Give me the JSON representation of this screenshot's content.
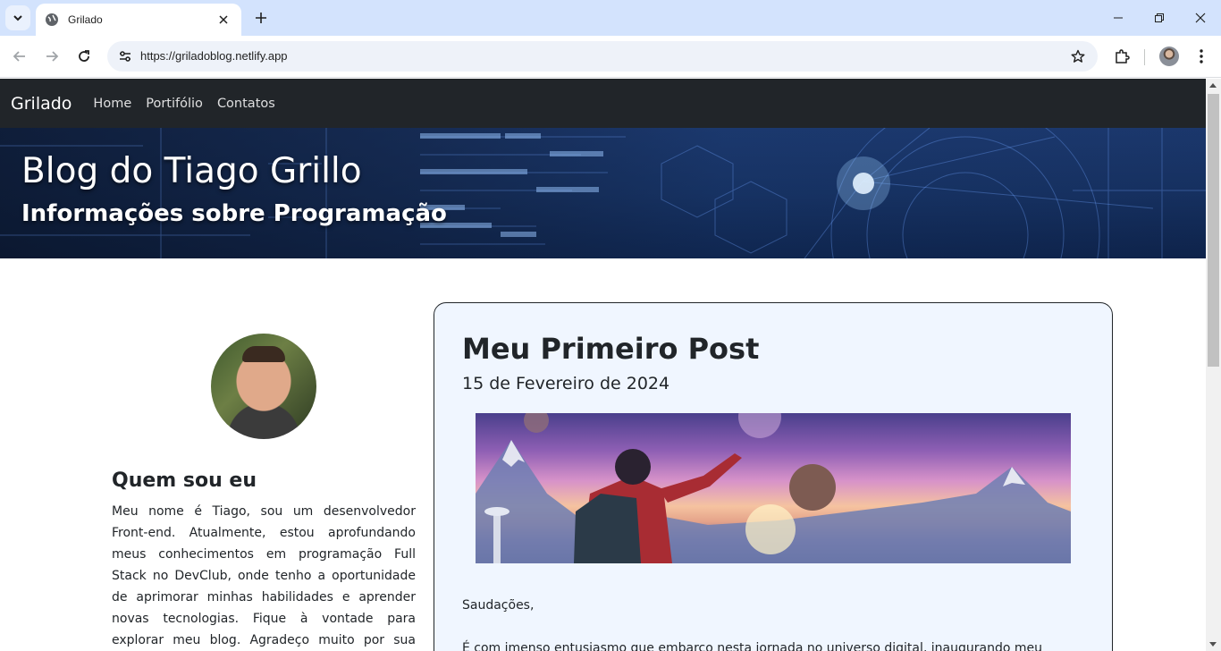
{
  "browser": {
    "tab_title": "Grilado",
    "url": "https://griladoblog.netlify.app"
  },
  "site": {
    "brand": "Grilado",
    "nav": [
      "Home",
      "Portifólio",
      "Contatos"
    ]
  },
  "hero": {
    "title": "Blog do Tiago Grillo",
    "subtitle": "Informações sobre Programação"
  },
  "about": {
    "title": "Quem sou eu",
    "text": "Meu nome é Tiago, sou um desenvolvedor Front-end. Atualmente, estou aprofundando meus conhecimentos em programação Full Stack no DevClub, onde tenho a oportunidade de aprimorar minhas habilidades e aprender novas tecnologias. Fique à vontade para explorar meu blog. Agradeço muito por sua visita."
  },
  "post": {
    "title": "Meu Primeiro Post",
    "date": "15 de Fevereiro de 2024",
    "greeting": "Saudações,",
    "paragraph": "É com imenso entusiasmo que embarco nesta jornada no universo digital, inaugurando meu"
  },
  "colors": {
    "navbar": "#212529",
    "post_background": "#f0f6ff",
    "tabstrip": "#d3e3fd"
  }
}
